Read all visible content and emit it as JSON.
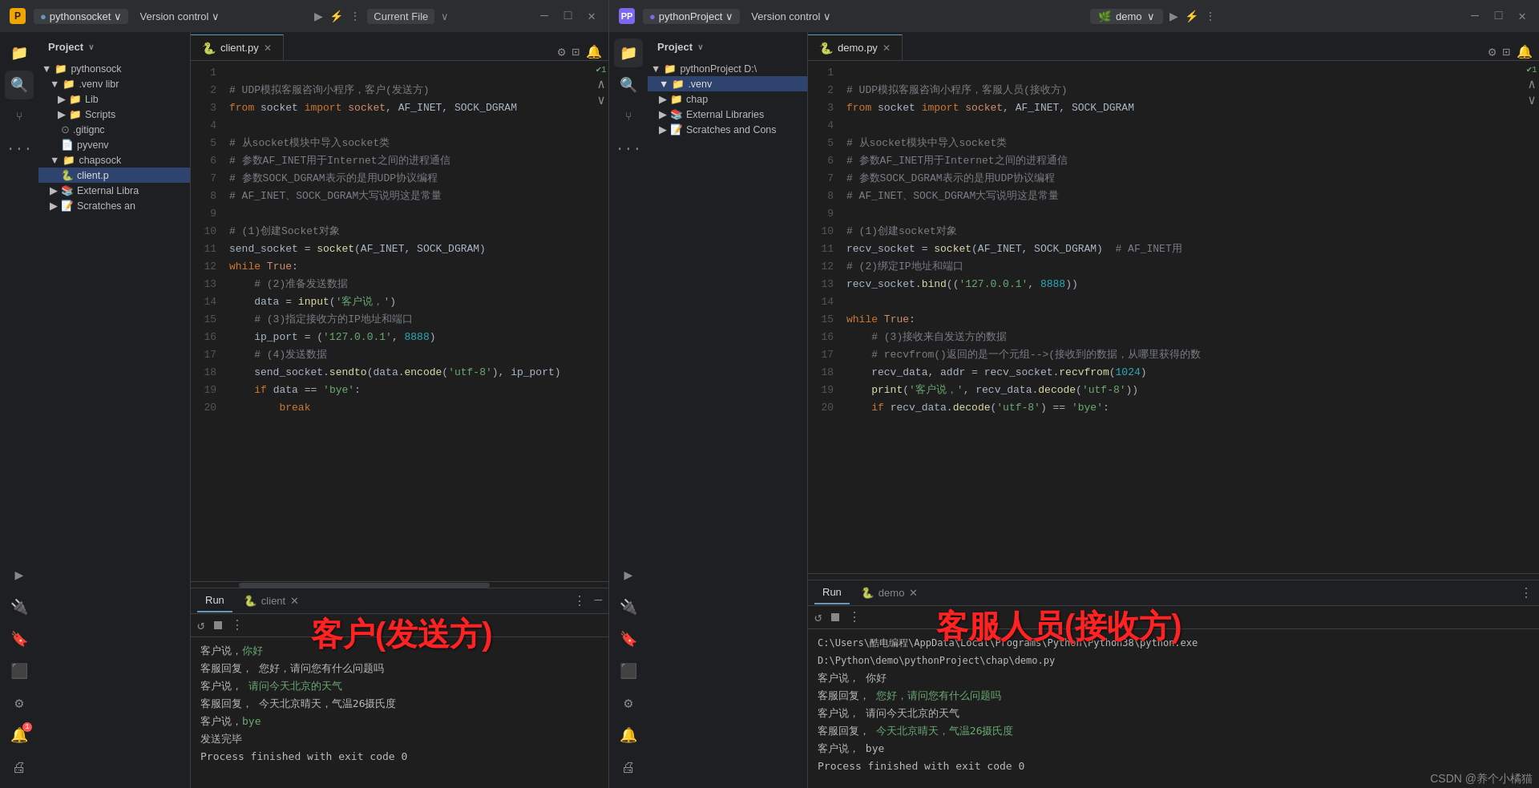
{
  "left": {
    "titleBar": {
      "icon": "🟡",
      "projectName": "pythonsocket",
      "projectChevron": "∨",
      "menu": [
        "Version control",
        "∨"
      ],
      "centerLabel": "Current File",
      "centerChevron": "∨",
      "winBtns": [
        "—",
        "□",
        "✕"
      ]
    },
    "sidebar": {
      "header": "Project",
      "headerChevron": "∨",
      "tree": [
        {
          "indent": 0,
          "type": "folder",
          "label": "pythonsock",
          "expanded": true
        },
        {
          "indent": 1,
          "type": "folder",
          "label": ".venv  libr",
          "expanded": true
        },
        {
          "indent": 2,
          "type": "folder",
          "label": "Lib",
          "expanded": false
        },
        {
          "indent": 2,
          "type": "folder",
          "label": "Scripts",
          "expanded": false
        },
        {
          "indent": 2,
          "type": "file",
          "label": ".gitignc",
          "icon": "git"
        },
        {
          "indent": 2,
          "type": "file",
          "label": "pyvenv",
          "icon": "file"
        },
        {
          "indent": 1,
          "type": "folder",
          "label": "chapsock",
          "expanded": true
        },
        {
          "indent": 2,
          "type": "pyfile",
          "label": "client.p",
          "active": true
        },
        {
          "indent": 1,
          "type": "folder",
          "label": "External Libra",
          "expanded": false
        },
        {
          "indent": 1,
          "type": "folder",
          "label": "Scratches an",
          "expanded": false
        }
      ]
    },
    "editor": {
      "tabLabel": "client.py",
      "lines": [
        {
          "n": 1,
          "code": "  # UDP模拟客服咨询小程序，客户(发送方)"
        },
        {
          "n": 2,
          "code": "  from socket import socket, AF_INET, SOCK_DGRAM"
        },
        {
          "n": 3,
          "code": ""
        },
        {
          "n": 4,
          "code": "  # 从socket模块中导入socket类"
        },
        {
          "n": 5,
          "code": "  # 参数AF_INET用于Internet之间的进程通信"
        },
        {
          "n": 6,
          "code": "  # 参数SOCK_DGRAM表示的是用UDP协议编程"
        },
        {
          "n": 7,
          "code": "  # AF_INET、SOCK_DGRAM大写说明这是常量"
        },
        {
          "n": 8,
          "code": ""
        },
        {
          "n": 9,
          "code": "  # (1)创建Socket对象"
        },
        {
          "n": 10,
          "code": "  send_socket = socket(AF_INET, SOCK_DGRAM)"
        },
        {
          "n": 11,
          "code": "  while True:"
        },
        {
          "n": 12,
          "code": "      # (2)准备发送数据"
        },
        {
          "n": 13,
          "code": "      data = input('客户说，')"
        },
        {
          "n": 14,
          "code": "      # (3)指定接收方的IP地址和端口"
        },
        {
          "n": 15,
          "code": "      ip_port = ('127.0.0.1', 8888)"
        },
        {
          "n": 16,
          "code": "      # (4)发送数据"
        },
        {
          "n": 17,
          "code": "      send_socket.sendto(data.encode('utf-8'), ip_port)"
        },
        {
          "n": 18,
          "code": "      if data == 'bye':"
        },
        {
          "n": 19,
          "code": "          break"
        },
        {
          "n": 20,
          "code": ""
        }
      ]
    },
    "runPanel": {
      "tabLabel": "Run",
      "fileLabel": "client",
      "lines": [
        {
          "text": "客户说，你好",
          "color": "#bbb"
        },
        {
          "text": "客服回复，  您好，请问您有什么问题吗",
          "color": "#bbb"
        },
        {
          "text": "客户说，  请问今天北京的天气",
          "color": "#6aab73"
        },
        {
          "text": "客服回复，  今天北京晴天，气温26摄氏度",
          "color": "#bbb"
        },
        {
          "text": "客户说，bye",
          "color": "#6aab73"
        },
        {
          "text": "发送完毕",
          "color": "#bbb"
        },
        {
          "text": "",
          "color": "#bbb"
        },
        {
          "text": "Process finished with exit code 0",
          "color": "#bbb"
        }
      ],
      "annotation": "客户(发送方)"
    }
  },
  "right": {
    "titleBar": {
      "icon": "🟣",
      "projectName": "pythonProject",
      "projectChevron": "∨",
      "menu": [
        "Version control",
        "∨"
      ],
      "branchName": "demo",
      "branchChevron": "∨",
      "winBtns": [
        "—",
        "□",
        "✕"
      ]
    },
    "sidebar": {
      "header": "Project",
      "headerChevron": "∨",
      "tree": [
        {
          "indent": 0,
          "type": "folder",
          "label": "pythonProject D:\\",
          "expanded": true
        },
        {
          "indent": 1,
          "type": "folder",
          "label": ".venv",
          "expanded": true,
          "selected": true
        },
        {
          "indent": 1,
          "type": "folder",
          "label": "chap",
          "expanded": false
        },
        {
          "indent": 1,
          "type": "folder",
          "label": "External Libraries",
          "expanded": false
        },
        {
          "indent": 1,
          "type": "folder",
          "label": "Scratches and Cons",
          "expanded": false
        }
      ]
    },
    "editor": {
      "tabLabel": "demo.py",
      "lines": [
        {
          "n": 1,
          "code": "  # UDP模拟客服咨询小程序，客服人员(接收方)"
        },
        {
          "n": 2,
          "code": "  from socket import socket, AF_INET, SOCK_DGRAM"
        },
        {
          "n": 3,
          "code": ""
        },
        {
          "n": 4,
          "code": "  # 从socket模块中导入socket类"
        },
        {
          "n": 5,
          "code": "  # 参数AF_INET用于Internet之间的进程通信"
        },
        {
          "n": 6,
          "code": "  # 参数SOCK_DGRAM表示的是用UDP协议编程"
        },
        {
          "n": 7,
          "code": "  # AF_INET、SOCK_DGRAM大写说明这是常量"
        },
        {
          "n": 8,
          "code": ""
        },
        {
          "n": 9,
          "code": "  # (1)创建socket对象"
        },
        {
          "n": 10,
          "code": "  recv_socket = socket(AF_INET, SOCK_DGRAM)  # AF_INET用"
        },
        {
          "n": 11,
          "code": "  # (2)绑定IP地址和端口"
        },
        {
          "n": 12,
          "code": "  recv_socket.bind(('127.0.0.1', 8888))"
        },
        {
          "n": 13,
          "code": ""
        },
        {
          "n": 14,
          "code": "  while True:"
        },
        {
          "n": 15,
          "code": "      # (3)接收来自发送方的数据"
        },
        {
          "n": 16,
          "code": "      # recvfrom()返回的是一个元组-->(接收到的数据，从哪里获得的数"
        },
        {
          "n": 17,
          "code": "      recv_data, addr = recv_socket.recvfrom(1024)"
        },
        {
          "n": 18,
          "code": "      print('客户说，', recv_data.decode('utf-8'))"
        },
        {
          "n": 19,
          "code": "      if recv_data.decode('utf-8') == 'bye':"
        },
        {
          "n": 20,
          "code": ""
        }
      ]
    },
    "runPanel": {
      "tabLabel": "Run",
      "fileLabel": "demo",
      "toolbarLines": [
        "C:\\Users\\酷电编程\\AppData\\Local\\Programs\\Python\\Python38\\python.exe",
        " D:\\Python\\demo\\pythonProject\\chap\\demo.py"
      ],
      "lines": [
        {
          "text": "客户说，  你好",
          "color": "#bbb"
        },
        {
          "text": "客服回复，  您好，请问您有什么问题吗",
          "color": "#6aab73"
        },
        {
          "text": "客户说，  请问今天北京的天气",
          "color": "#bbb"
        },
        {
          "text": "客服回复，  今天北京晴天，气温26摄氏度",
          "color": "#6aab73"
        },
        {
          "text": "客户说，  bye",
          "color": "#bbb"
        },
        {
          "text": "",
          "color": "#bbb"
        },
        {
          "text": "Process finished with exit code 0",
          "color": "#bbb"
        }
      ],
      "annotation": "客服人员(接收方)"
    }
  },
  "watermark": "CSDN @养个小橘猫"
}
